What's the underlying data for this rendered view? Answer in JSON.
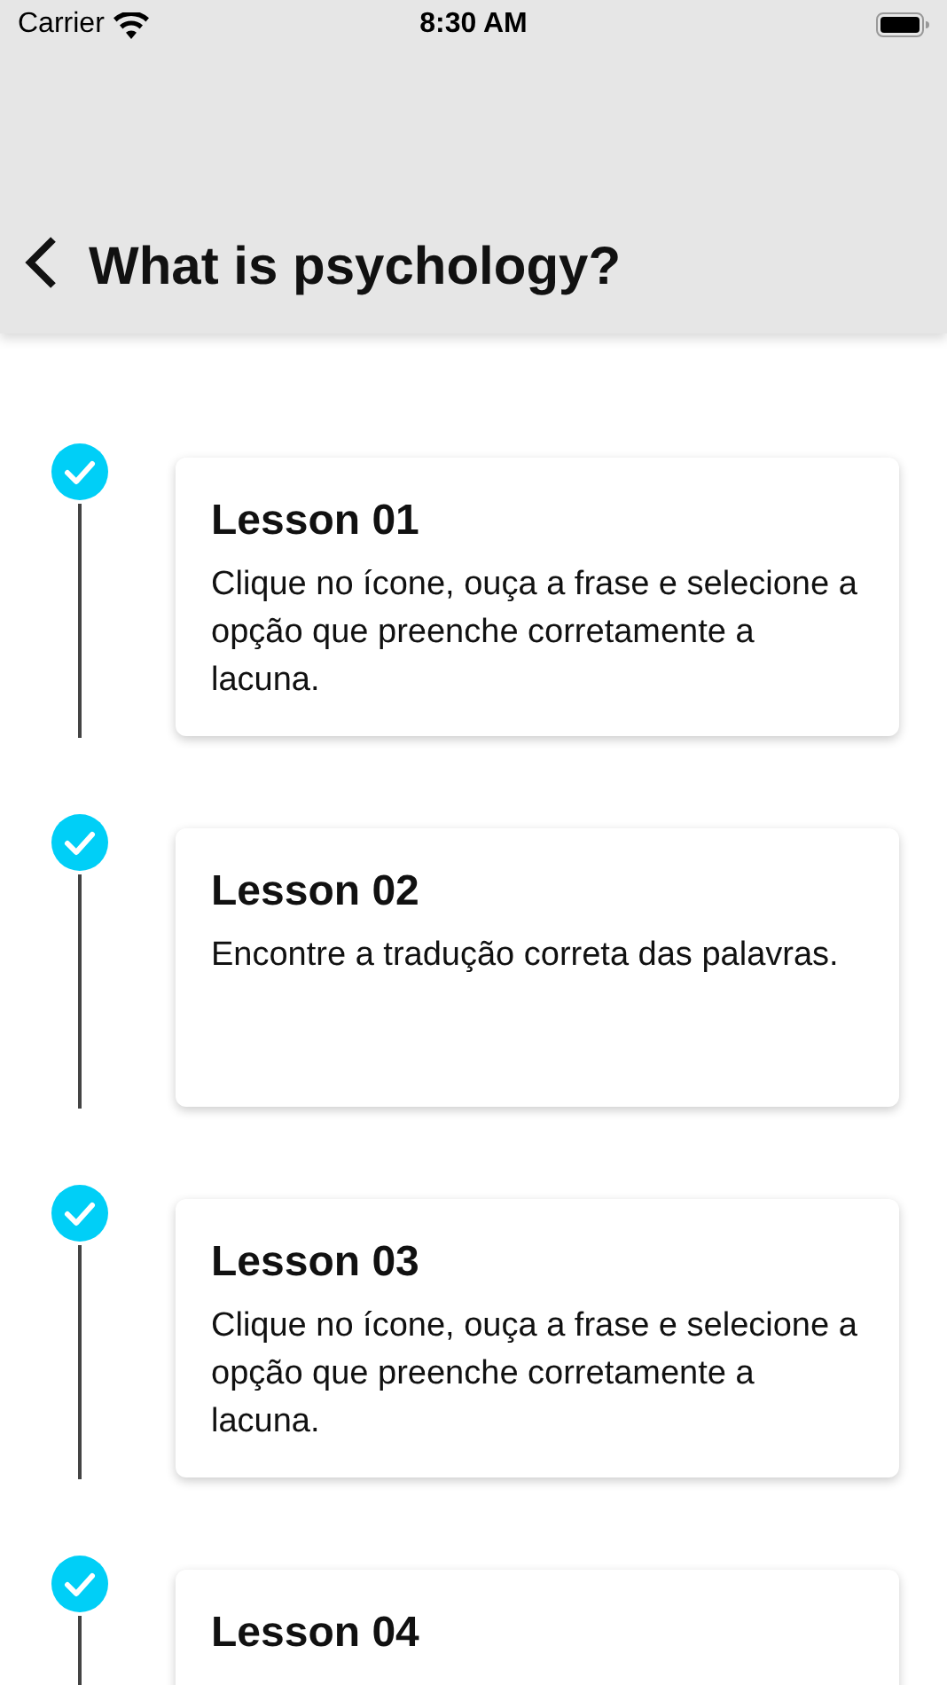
{
  "status_bar": {
    "carrier": "Carrier",
    "time": "8:30 AM"
  },
  "nav_bar": {
    "title": "What is psychology?"
  },
  "lessons": [
    {
      "title": "Lesson 01",
      "description": "Clique no ícone, ouça a frase e selecione a opção que preenche corretamente a lacuna.",
      "completed": true
    },
    {
      "title": "Lesson 02",
      "description": "Encontre a tradução correta das palavras.",
      "completed": true
    },
    {
      "title": "Lesson 03",
      "description": "Clique no ícone, ouça a frase e selecione a opção que preenche corretamente a lacuna.",
      "completed": true
    },
    {
      "title": "Lesson 04",
      "completed": true
    }
  ]
}
